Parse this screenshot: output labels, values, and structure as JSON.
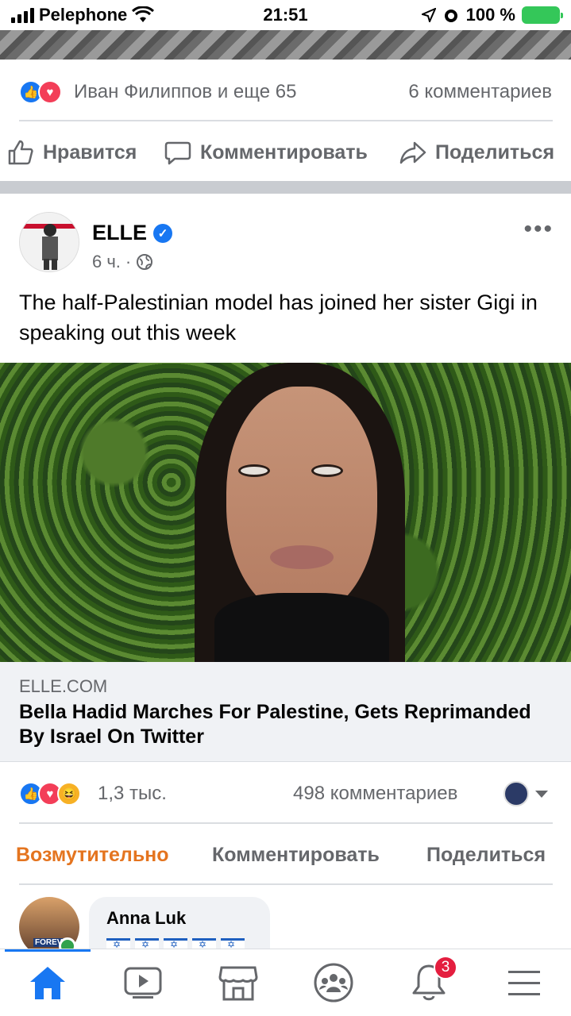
{
  "status_bar": {
    "carrier": "Pelephone",
    "time": "21:51",
    "battery": "100 %"
  },
  "prev_post": {
    "reactions_text": "Иван Филиппов и еще 65",
    "comments_text": "6 комментариев",
    "actions": {
      "like": "Нравится",
      "comment": "Комментировать",
      "share": "Поделиться"
    }
  },
  "post": {
    "author": "ELLE",
    "time": "6 ч.",
    "text": "The half-Palestinian model has joined her sister Gigi in speaking out this week",
    "link": {
      "domain": "ELLE.COM",
      "title": "Bella Hadid Marches For Palestine, Gets Reprimanded By Israel On Twitter"
    },
    "reaction_count": "1,3 тыс.",
    "comments_text": "498 комментариев",
    "actions": {
      "react": "Возмутительно",
      "comment": "Комментировать",
      "share": "Поделиться"
    },
    "colors": {
      "selected_reaction": "#e4741f",
      "brand": "#1877f2"
    }
  },
  "comment": {
    "author": "Anna Luk",
    "avatar_text": "FOREV"
  },
  "tab_bar": {
    "icons": [
      "home-icon",
      "video-icon",
      "marketplace-icon",
      "groups-icon",
      "notifications-icon",
      "menu-icon"
    ],
    "notifications_badge": "3"
  }
}
